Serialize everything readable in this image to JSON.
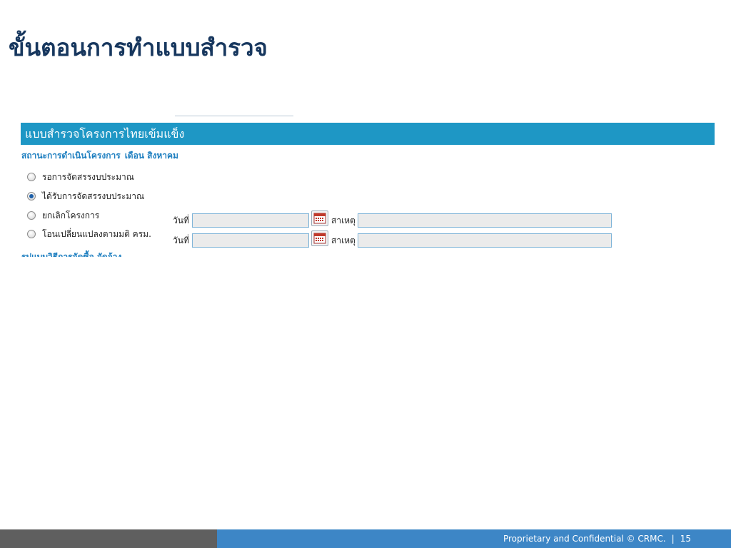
{
  "slide": {
    "title": "ขั้นตอนการทำแบบสำรวจ"
  },
  "form": {
    "header": "แบบสำรวจโครงการไทยเข้มแข็ง",
    "status_heading": "สถานะการดำเนินโครงการ",
    "status_month": "เดือน สิงหาคม",
    "options": [
      "รอการจัดสรรงบประมาณ",
      "ได้รับการจัดสรรงบประมาณ",
      "ยกเลิกโครงการ",
      "โอนเปลี่ยนแปลงตามมติ ครม."
    ],
    "selected_option": "ได้รับการจัดสรรงบประมาณ",
    "date_label": "วันที่",
    "reason_label": "สาเหตุ",
    "rows": [
      {
        "date": "",
        "reason": ""
      },
      {
        "date": "",
        "reason": ""
      }
    ],
    "next_section_partial": "รูปแบบวิธีการจัดซื้อ จัดจ้าง"
  },
  "footer": {
    "copyright": "Proprietary and Confidential © CRMC.",
    "separator": "|",
    "page_number": "15"
  },
  "colors": {
    "title": "#17375e",
    "header_bar": "#1e97c5",
    "section_heading": "#1e7fc0",
    "footer_left": "#5f5f5f",
    "footer_right": "#3d86c6"
  },
  "icons": {
    "calendar_button": "calendar-icon",
    "radio": "radio-button"
  }
}
